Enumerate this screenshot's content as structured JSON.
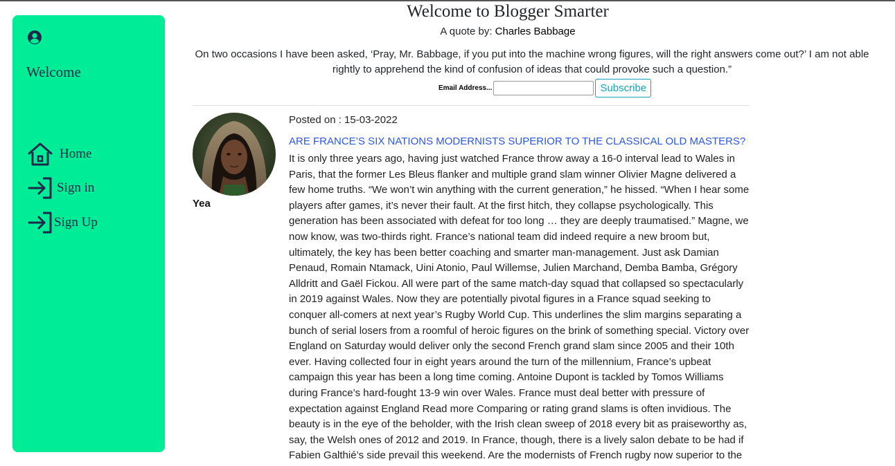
{
  "sidebar": {
    "welcome": "Welcome",
    "items": [
      {
        "label": "Home",
        "icon": "home-icon"
      },
      {
        "label": "Sign in",
        "icon": "sign-in-icon"
      },
      {
        "label": "Sign Up",
        "icon": "sign-up-icon"
      }
    ],
    "profile_icon": "user-circle-icon",
    "background": "#00ec96",
    "text_color": "#1b2a4a"
  },
  "header": {
    "title": "Welcome to Blogger Smarter",
    "quote_prefix": "A quote by:",
    "quote_author": "Charles Babbage",
    "quote": "On two occasions I have been asked, ‘Pray, Mr. Babbage, if you put into the machine wrong figures, will the right answers come out?’ I am not able rightly to apprehend the kind of confusion of ideas that could provoke such a question.”"
  },
  "subscribe": {
    "email_label": "Email Address...",
    "email_value": "",
    "button_label": "Subscribe",
    "accent": "#17a2b8"
  },
  "post": {
    "author": "Yea",
    "posted_on": "Posted on : 15-03-2022",
    "title": "ARE FRANCE’S SIX NATIONS MODERNISTS SUPERIOR TO THE CLASSICAL OLD MASTERS?",
    "title_color": "#2b56e8",
    "body": "It is only three years ago, having just watched France throw away a 16-0 interval lead to Wales in Paris, that the former Les Bleus flanker and multiple grand slam winner Olivier Magne delivered a few home truths. “We won’t win anything with the current generation,” he hissed. “When I hear some players after games, it’s never their fault. At the first hitch, they collapse psychologically. This generation has been associated with defeat for too long … they are deeply traumatised.” Magne, we now know, was two-thirds right. France’s national team did indeed require a new broom but, ultimately, the key has been better coaching and smarter man-management. Just ask Damian Penaud, Romain Ntamack, Uini Atonio, Paul Willemse, Julien Marchand, Demba Bamba, Grégory Alldritt and Gaël Fickou. All were part of the same match-day squad that collapsed so spectacularly in 2019 against Wales. Now they are potentially pivotal figures in a France squad seeking to conquer all-comers at next year’s Rugby World Cup. This underlines the slim margins separating a bunch of serial losers from a roomful of heroic figures on the brink of something special. Victory over England on Saturday would deliver only the second French grand slam since 2005 and their 10th ever. Having collected four in eight years around the turn of the millennium, France’s upbeat campaign this year has been a long time coming. Antoine Dupont is tackled by Tomos Williams during France’s hard-fought 13-9 win over Wales. France must deal better with pressure of expectation against England Read more Comparing or rating grand slams is often invidious. The beauty is in the eye of the beholder, with the Irish clean sweep of 2018 every bit as praiseworthy as, say, the Welsh ones of 2012 and 2019. In France, though, there is a lively salon debate to be had if Fabien Galthié’s side prevail this weekend. Are the modernists of French rugby now superior to the"
  }
}
